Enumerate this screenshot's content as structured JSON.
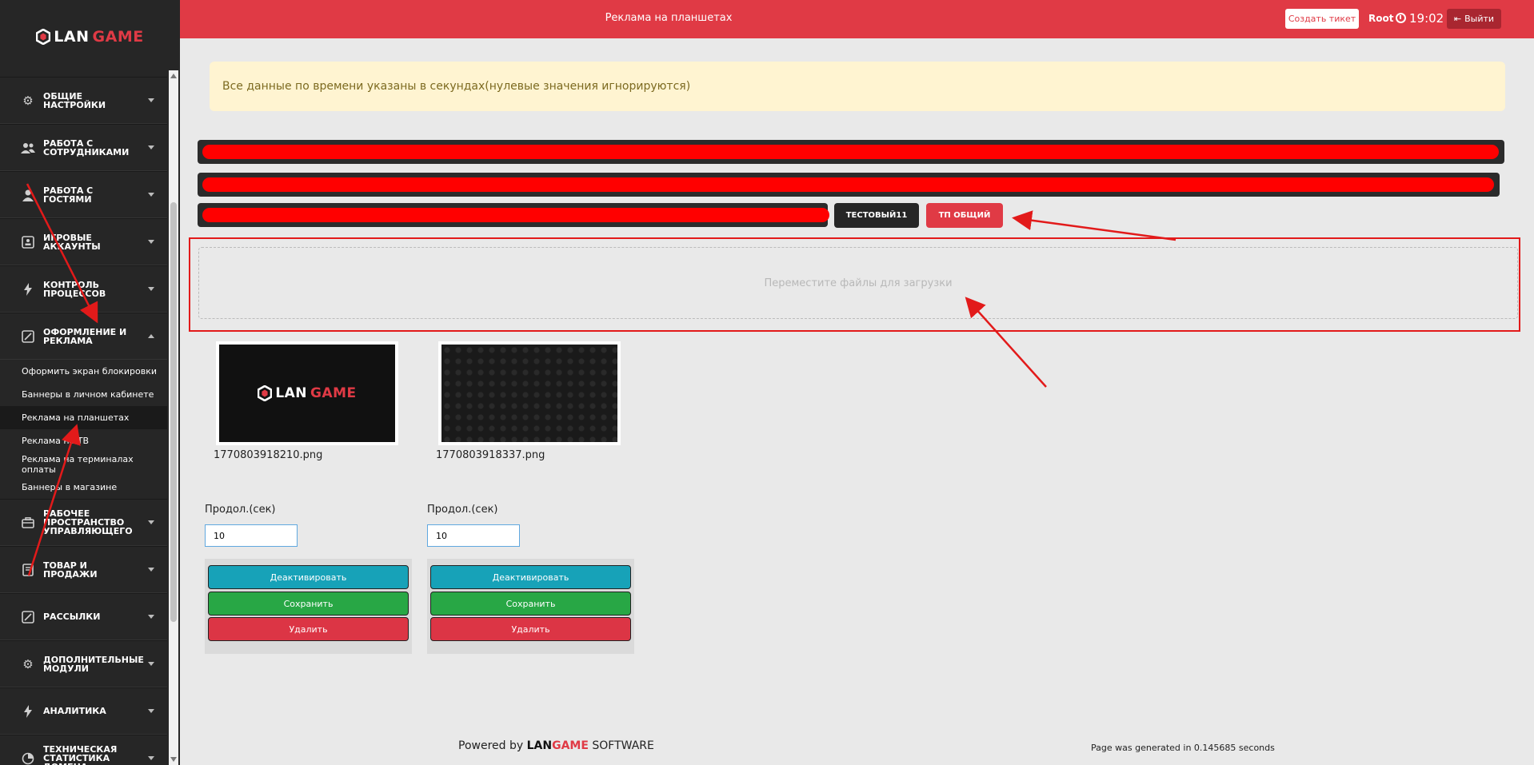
{
  "logo": {
    "lan": "LAN",
    "game": "GAME"
  },
  "sidebar": {
    "items": [
      {
        "label": "Общие настройки",
        "icon": "gear-icon"
      },
      {
        "label": "Работа с сотрудниками",
        "icon": "users-icon"
      },
      {
        "label": "Работа с гостями",
        "icon": "user-icon"
      },
      {
        "label": "Игровые аккаунты",
        "icon": "id-card-icon"
      },
      {
        "label": "Контроль процессов",
        "icon": "bolt-icon"
      },
      {
        "label": "Оформление и реклама",
        "icon": "edit-icon"
      }
    ],
    "submenu": [
      "Оформить экран блокировки",
      "Баннеры в личном кабинете",
      "Реклама на планшетах",
      "Реклама на ТВ",
      "Реклама на терминалах оплаты",
      "Баннеры в магазине"
    ],
    "items_after": [
      {
        "label": "Рабочее пространство управляющего",
        "icon": "briefcase-icon"
      },
      {
        "label": "Товар и продажи",
        "icon": "receipt-icon"
      },
      {
        "label": "Рассылки",
        "icon": "edit-icon"
      },
      {
        "label": "Дополнительные модули",
        "icon": "gear-icon"
      },
      {
        "label": "Аналитика",
        "icon": "bolt-icon"
      },
      {
        "label": "Техническая статистика домена",
        "icon": "pie-icon"
      }
    ]
  },
  "header": {
    "title": "Реклама на планшетах",
    "ticket_label": "Создать тикет",
    "user": "Root",
    "time": "19:02",
    "logout_label": "Выйти"
  },
  "alert": "Все данные по времени указаны в секундах(нулевые значения игнорируются)",
  "tabs": {
    "dark_label": "Тестовый11",
    "active_label": "ТП общий"
  },
  "dropzone": "Переместите файлы для загрузки",
  "cards": [
    {
      "filename": "1770803918210.png",
      "duration_label": "Продол.(сек)",
      "duration_value": "10",
      "deactivate": "Деактивировать",
      "save": "Сохранить",
      "delete": "Удалить"
    },
    {
      "filename": "1770803918337.png",
      "duration_label": "Продол.(сек)",
      "duration_value": "10",
      "deactivate": "Деактивировать",
      "save": "Сохранить",
      "delete": "Удалить"
    }
  ],
  "footer": {
    "powered_by": "Powered by",
    "brand_l": "LAN",
    "brand_g": "GAME",
    "software": "SOFTWARE",
    "generated": "Page was generated in 0.145685 seconds"
  },
  "colors": {
    "accent": "#e03a45",
    "sidebar_bg": "#262626"
  }
}
